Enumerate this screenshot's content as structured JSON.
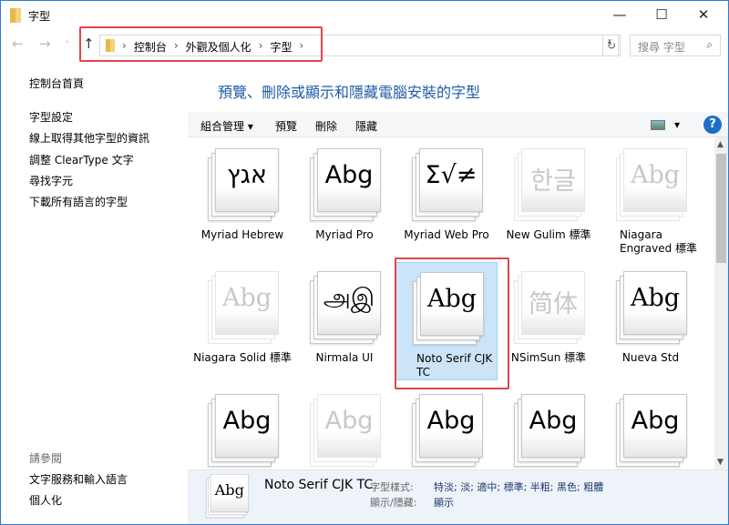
{
  "window": {
    "title": "字型",
    "minimize": "—",
    "maximize": "☐",
    "close": "✕"
  },
  "nav": {
    "back": "←",
    "forward": "→",
    "recent": "˅",
    "up": "↑",
    "breadcrumbs": [
      "控制台",
      "外觀及個人化",
      "字型"
    ],
    "separator": "›",
    "search_placeholder": "搜尋 字型",
    "search_icon": "⌕",
    "refresh": "↻",
    "dropdown": "˅"
  },
  "sidebar": {
    "home": "控制台首頁",
    "links": [
      "字型設定",
      "線上取得其他字型的資訊",
      "調整 ClearType 文字",
      "尋找字元",
      "下載所有語言的字型"
    ],
    "see_also": "請參閱",
    "see_also_links": [
      "文字服務和輸入語言",
      "個人化"
    ]
  },
  "main": {
    "heading": "預覽、刪除或顯示和隱藏電腦安裝的字型"
  },
  "toolbar": {
    "organize": "組合管理 ▾",
    "preview": "預覽",
    "delete": "刪除",
    "hide": "隱藏",
    "view": "▾",
    "help": "?"
  },
  "fonts": [
    {
      "name": "Myriad Hebrew",
      "glyph": "אגץ",
      "faded": false,
      "serif": false
    },
    {
      "name": "Myriad Pro",
      "glyph": "Abg",
      "faded": false,
      "serif": false
    },
    {
      "name": "Myriad Web Pro",
      "glyph": "Σ√≠",
      "faded": false,
      "serif": false
    },
    {
      "name": "New Gulim 標準",
      "glyph": "한글",
      "faded": true,
      "serif": false
    },
    {
      "name": "Niagara Engraved 標準",
      "glyph": "Abg",
      "faded": true,
      "serif": true
    },
    {
      "name": "Niagara Solid 標準",
      "glyph": "Abg",
      "faded": true,
      "serif": true
    },
    {
      "name": "Nirmala UI",
      "glyph": "அஇ",
      "faded": false,
      "serif": false
    },
    {
      "name": "Noto Serif CJK TC",
      "glyph": "Abg",
      "faded": false,
      "serif": true,
      "selected": true
    },
    {
      "name": "NSimSun 標準",
      "glyph": "简体",
      "faded": true,
      "serif": false
    },
    {
      "name": "Nueva Std",
      "glyph": "Abg",
      "faded": false,
      "serif": true
    },
    {
      "name": "",
      "glyph": "Abg",
      "faded": false,
      "serif": false
    },
    {
      "name": "",
      "glyph": "Abg",
      "faded": true,
      "serif": false
    },
    {
      "name": "",
      "glyph": "Abg",
      "faded": false,
      "serif": false
    },
    {
      "name": "",
      "glyph": "Abg",
      "faded": false,
      "serif": false
    },
    {
      "name": "",
      "glyph": "Abg",
      "faded": false,
      "serif": false
    }
  ],
  "details": {
    "name": "Noto Serif CJK TC",
    "glyph": "Abg",
    "style_label": "字型樣式:",
    "style_value": "特淡; 淡; 適中; 標準; 半粗; 黑色; 粗體",
    "show_label": "顯示/隱藏:",
    "show_value": "顯示"
  }
}
